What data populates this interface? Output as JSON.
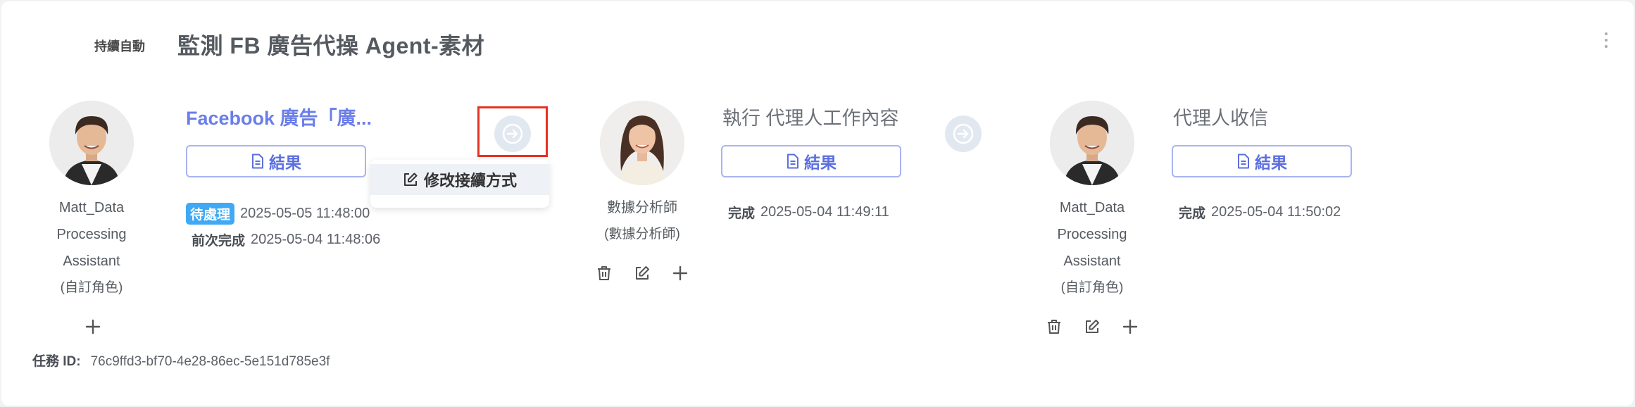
{
  "header": {
    "mode_label": "持續自動",
    "workflow_title": "監測 FB 廣告代操 Agent-素材"
  },
  "steps": [
    {
      "agent_name": [
        "Matt_Data",
        "Processing",
        "Assistant"
      ],
      "agent_role": "(自訂角色)",
      "title": "Facebook 廣告「廣...",
      "result_label": "結果",
      "status_badge": "待處理",
      "status_time": "2025-05-05 11:48:00",
      "prev_label": "前次完成",
      "prev_time": "2025-05-04 11:48:06"
    },
    {
      "agent_name": [
        "數據分析師"
      ],
      "agent_role": "(數據分析師)",
      "title": "執行 代理人工作內容",
      "result_label": "結果",
      "status_label": "完成",
      "status_time": "2025-05-04 11:49:11"
    },
    {
      "agent_name": [
        "Matt_Data",
        "Processing",
        "Assistant"
      ],
      "agent_role": "(自訂角色)",
      "title": "代理人收信",
      "result_label": "結果",
      "status_label": "完成",
      "status_time": "2025-05-04 11:50:02"
    }
  ],
  "context_menu": {
    "item_label": "修改接續方式"
  },
  "task": {
    "id_label": "任務 ID:",
    "id_value": "76c9ffd3-bf70-4e28-86ec-5e151d785e3f"
  },
  "colors": {
    "accent": "#5b6fe0",
    "badge": "#3fa9f5",
    "highlight": "#e53222"
  }
}
